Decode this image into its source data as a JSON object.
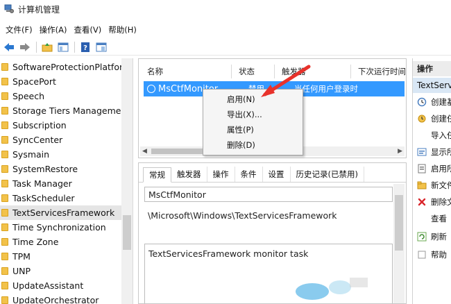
{
  "window": {
    "title": "计算机管理"
  },
  "menu": [
    "文件(F)",
    "操作(A)",
    "查看(V)",
    "帮助(H)"
  ],
  "toolbar": [
    "back-icon",
    "forward-icon",
    "up-folder-icon",
    "show-hide-tree-icon",
    "help-icon",
    "properties-view-icon"
  ],
  "tree": {
    "items": [
      "SoftwareProtectionPlatform",
      "SpacePort",
      "Speech",
      "Storage Tiers Management",
      "Subscription",
      "SyncCenter",
      "Sysmain",
      "SystemRestore",
      "Task Manager",
      "TaskScheduler",
      "TextServicesFramework",
      "Time Synchronization",
      "Time Zone",
      "TPM",
      "UNP",
      "UpdateAssistant",
      "UpdateOrchestrator"
    ],
    "selected": "TextServicesFramework"
  },
  "tasklist": {
    "columns": [
      "名称",
      "状态",
      "触发器",
      "下次运行时间"
    ],
    "rows": [
      {
        "name": "MsCtfMonitor",
        "status": "禁用",
        "trigger": "当任何用户登录时"
      }
    ]
  },
  "context_menu": [
    "启用(N)",
    "导出(X)...",
    "属性(P)",
    "删除(D)"
  ],
  "properties": {
    "tabs": [
      "常规",
      "触发器",
      "操作",
      "条件",
      "设置",
      "历史记录(已禁用)"
    ],
    "name": "MsCtfMonitor",
    "location": "\\Microsoft\\Windows\\TextServicesFramework",
    "description": "TextServicesFramework monitor task"
  },
  "actions": {
    "title": "操作",
    "subtitle": "TextServicesFramework",
    "items": [
      {
        "icon": "create-basic-task-icon",
        "label": "创建基本任务..."
      },
      {
        "icon": "create-task-icon",
        "label": "创建任务..."
      },
      {
        "icon": "import-icon",
        "label": "导入任务..."
      },
      {
        "icon": "display-running-icon",
        "label": "显示所有正在运行的任务"
      },
      {
        "icon": "enable-history-icon",
        "label": "启用所有任务历史记录"
      },
      {
        "icon": "new-folder-icon",
        "label": "新文件夹..."
      },
      {
        "icon": "delete-icon",
        "label": "删除文件夹"
      },
      {
        "icon": "view-icon",
        "label": "查看"
      },
      {
        "icon": "refresh-icon",
        "label": "刷新"
      },
      {
        "icon": "more-icon",
        "label": "帮助"
      }
    ]
  },
  "colors": {
    "selection": "#3399ff",
    "annotation_arrow": "#e8322b"
  }
}
